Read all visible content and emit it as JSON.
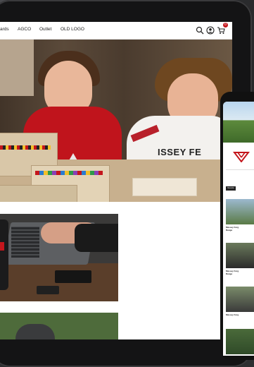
{
  "nav": {
    "links": [
      "ards",
      "AGCO",
      "Outlet",
      "OLD LOGO"
    ],
    "cart_count": "0"
  },
  "hero": {
    "shirt_text": "ISSEY FE"
  },
  "phone": {
    "filter_label": "Neueste",
    "cards": [
      {
        "title": "Massey Ferg",
        "title2": "Range"
      },
      {
        "title": "Massey Ferg",
        "title2": "Range"
      },
      {
        "title": "Massey Ferg",
        "title2": ""
      }
    ]
  },
  "colors": {
    "brand_red": "#c4161c",
    "text": "#222222"
  }
}
